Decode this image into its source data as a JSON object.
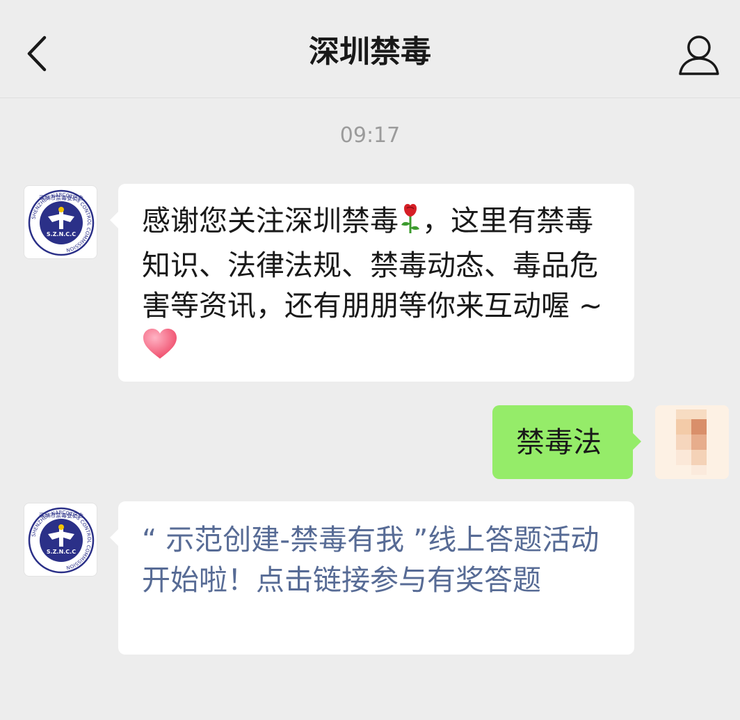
{
  "header": {
    "title": "深圳禁毒",
    "back_icon": "chevron-left-icon",
    "profile_icon": "person-icon"
  },
  "chat": {
    "timestamp": "09:17",
    "messages": [
      {
        "sender": "official",
        "text_part1": "感谢您关注深圳禁毒",
        "emoji1": "rose-emoji",
        "text_part2": "，这里有禁毒知识、法律法规、禁毒动态、毒品危害等资讯，还有朋朋等你来互动喔 ~",
        "emoji2": "heart-emoji"
      },
      {
        "sender": "user",
        "text": "禁毒法"
      },
      {
        "sender": "official",
        "link_text": "“ 示范创建-禁毒有我 ”线上答题活动开始啦！点击链接参与有奖答题"
      }
    ]
  },
  "avatar_logo": {
    "top_text": "深圳市禁毒委员会",
    "center_text": "S.Z.N.C.C",
    "ring_text": "SHENZHEN NARCOTICS CONTROL COMMISSION"
  },
  "colors": {
    "background": "#ededed",
    "bubble_incoming": "#ffffff",
    "bubble_outgoing": "#95ec69",
    "link_text": "#576b95",
    "timestamp": "#9b9b9b",
    "title": "#191919",
    "logo_blue": "#2b3088"
  }
}
